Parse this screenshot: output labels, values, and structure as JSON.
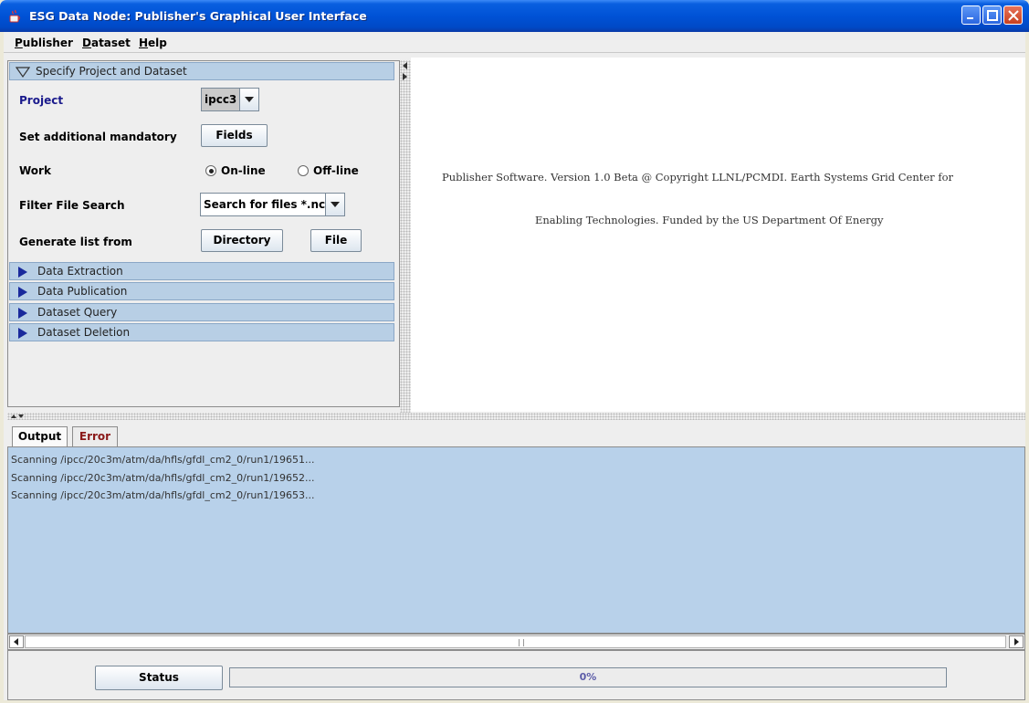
{
  "window": {
    "title": "ESG Data Node: Publisher's Graphical User Interface"
  },
  "menubar": {
    "items": [
      {
        "label": "Publisher",
        "mnemonic": "P",
        "rest": "ublisher"
      },
      {
        "label": "Dataset",
        "mnemonic": "D",
        "rest": "ataset"
      },
      {
        "label": "Help",
        "mnemonic": "H",
        "rest": "elp"
      }
    ]
  },
  "left_panel": {
    "sections": {
      "specify": "Specify Project and Dataset",
      "extraction": "Data Extraction",
      "publication": "Data Publication",
      "query": "Dataset Query",
      "deletion": "Dataset Deletion"
    },
    "form": {
      "project_label": "Project",
      "project_value": "ipcc3",
      "mandatory_label": "Set additional mandatory",
      "fields_button": "Fields",
      "work_label": "Work",
      "online_label": "On-line",
      "offline_label": "Off-line",
      "work_selected": "On-line",
      "filter_label": "Filter File Search",
      "filter_value": "Search for files *.nc",
      "generate_label": "Generate list from",
      "directory_button": "Directory",
      "file_button": "File"
    }
  },
  "info": {
    "line1": "Publisher Software. Version 1.0 Beta @ Copyright LLNL/PCMDI. Earth Systems Grid Center for",
    "line2": "Enabling Technologies. Funded by the US Department Of Energy"
  },
  "tabs": {
    "output": "Output",
    "error": "Error",
    "active": "Output"
  },
  "output": {
    "lines": [
      "Scanning /ipcc/20c3m/atm/da/hfls/gfdl_cm2_0/run1/19651...",
      "Scanning /ipcc/20c3m/atm/da/hfls/gfdl_cm2_0/run1/19652...",
      "Scanning /ipcc/20c3m/atm/da/hfls/gfdl_cm2_0/run1/19653..."
    ]
  },
  "status": {
    "button": "Status",
    "progress_text": "0%",
    "progress_value": 0
  },
  "colors": {
    "titlebar": "#0052d6",
    "section_header": "#b8cfe5",
    "output_bg": "#b8d1ea",
    "project_label": "#1a1a8c",
    "error_tab": "#8b1a1a"
  }
}
